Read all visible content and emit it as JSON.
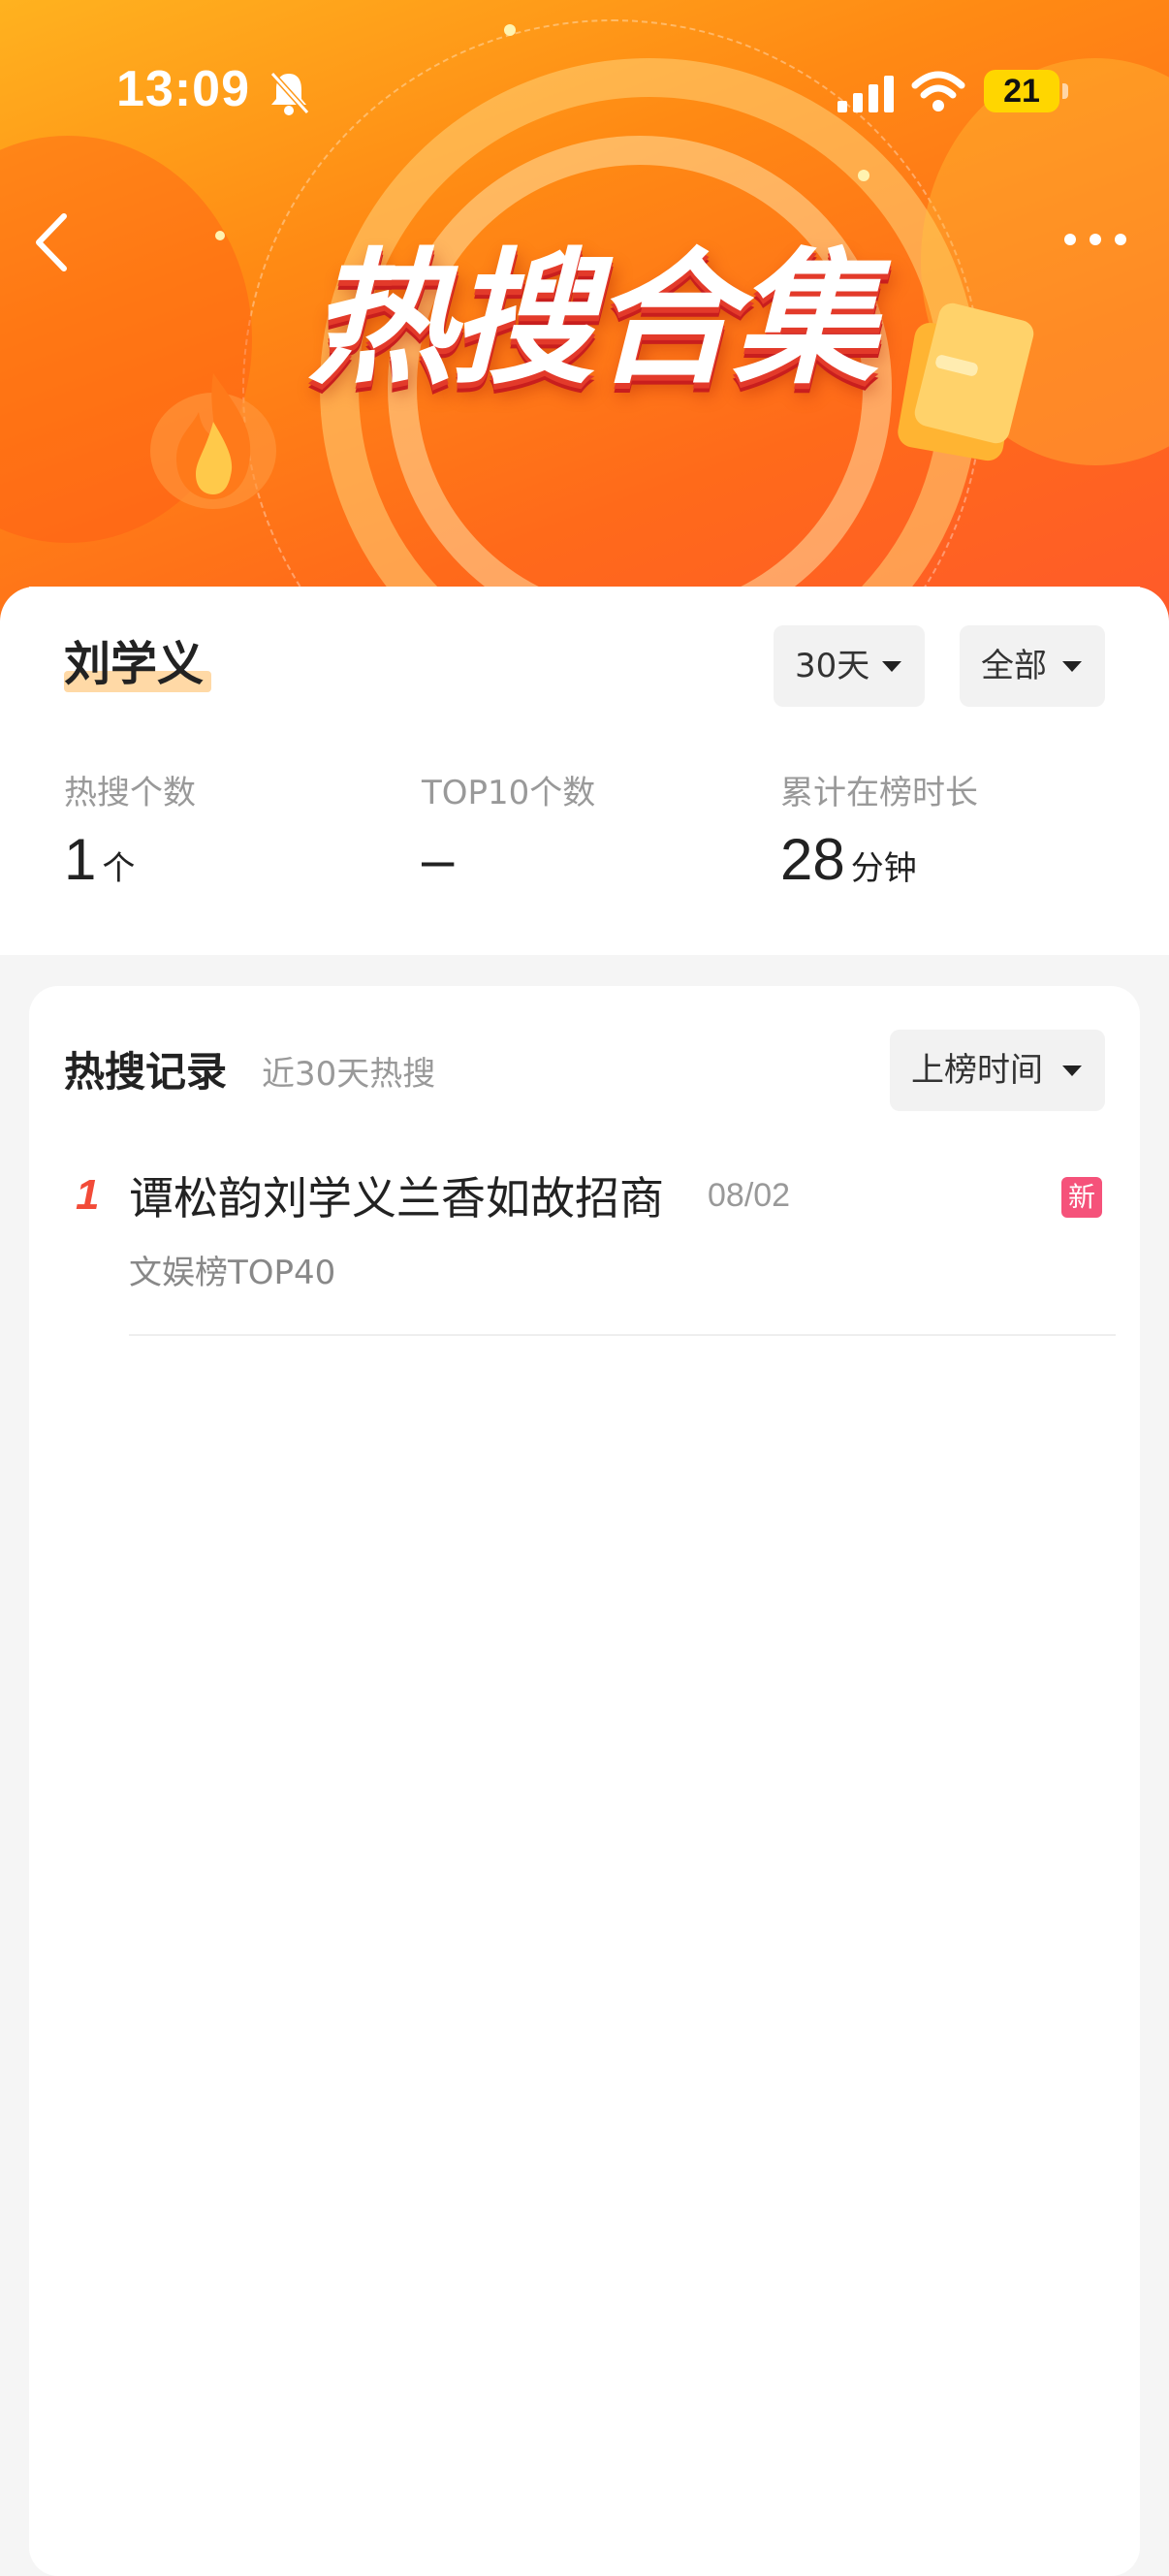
{
  "status_bar": {
    "time": "13:09",
    "battery": "21",
    "icons": [
      "bell-slash-icon",
      "signal-icon",
      "wifi-icon",
      "battery-icon"
    ]
  },
  "header": {
    "banner_title": "热搜合集",
    "back_icon": "chevron-left-icon",
    "more_icon": "more-dots-icon"
  },
  "summary": {
    "name": "刘学义",
    "period_filter": "30天",
    "scope_filter": "全部",
    "stats": [
      {
        "label": "热搜个数",
        "value": "1",
        "unit": "个"
      },
      {
        "label": "TOP10个数",
        "value": "–",
        "unit": ""
      },
      {
        "label": "累计在榜时长",
        "value": "28",
        "unit": "分钟"
      }
    ]
  },
  "records": {
    "title": "热搜记录",
    "subtitle": "近30天热搜",
    "sort_label": "上榜时间",
    "items": [
      {
        "rank": "1",
        "title": "谭松韵刘学义兰香如故招商",
        "date": "08/02",
        "badge": "新",
        "subtitle": "文娱榜TOP40"
      }
    ]
  },
  "colors": {
    "accent_orange": "#ff8a14",
    "rank_red": "#f24b38",
    "badge_pink": "#f5527a"
  }
}
